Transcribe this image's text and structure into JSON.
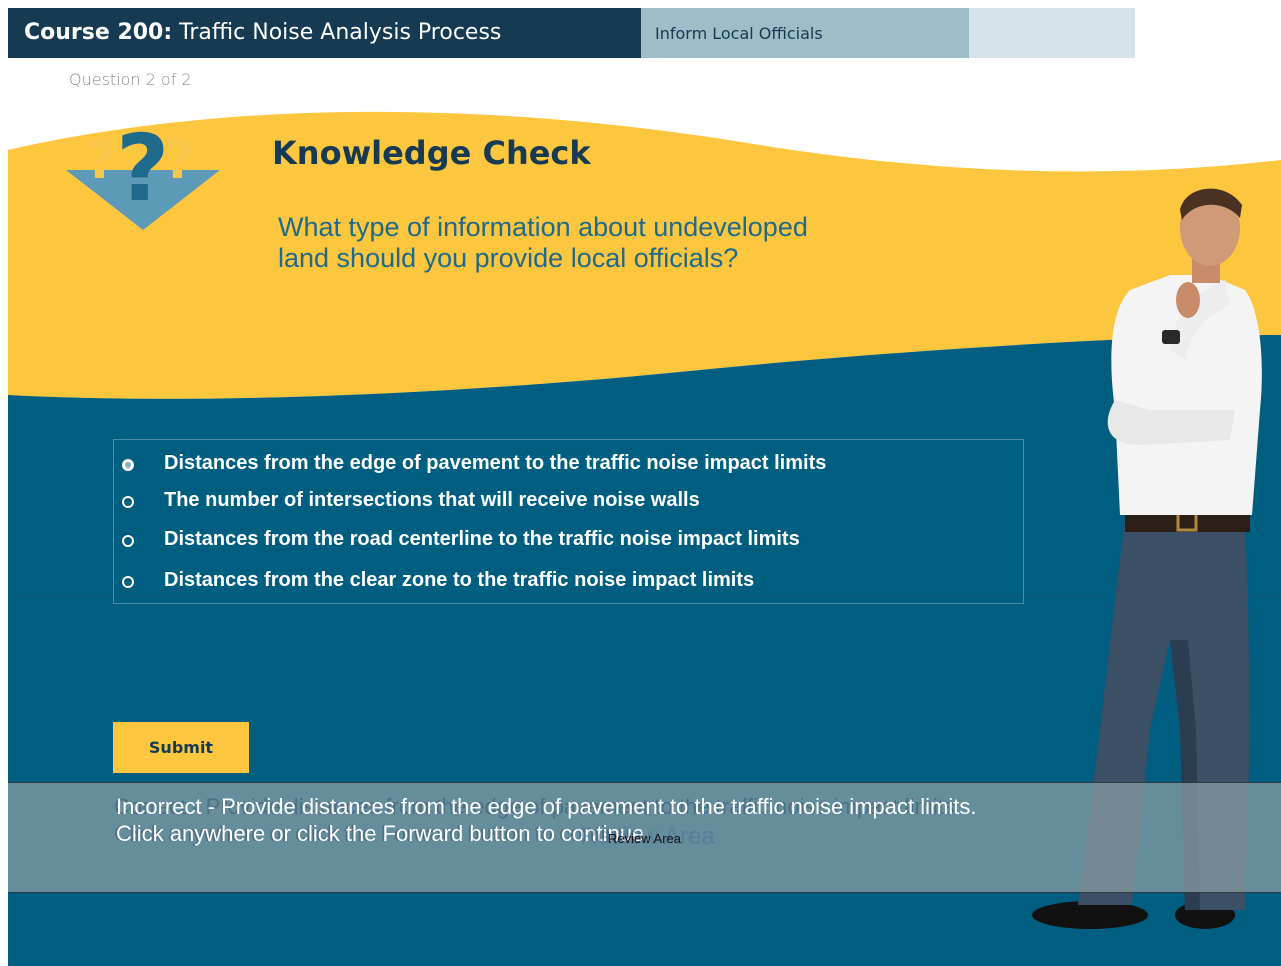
{
  "header": {
    "course_bold": "Course 200:",
    "course_title": "Traffic Noise Analysis Process",
    "tab_active": "Inform Local Officials"
  },
  "progress": "Question 2 of 2",
  "knowledge_check": {
    "title": "Knowledge Check",
    "question": "What type of information about undeveloped land should you provide local officials?"
  },
  "options": [
    {
      "label": "Distances from the edge of pavement to the traffic noise impact limits",
      "selected": true
    },
    {
      "label": "The number of intersections that will receive noise walls",
      "selected": false
    },
    {
      "label": "Distances from the road centerline to the traffic noise impact limits",
      "selected": false
    },
    {
      "label": "Distances from the clear zone to the traffic noise impact limits",
      "selected": false
    }
  ],
  "submit_label": "Submit",
  "feedback": {
    "overlay_ghost": "Correct - Provide distances from the edge of pavement to the traffic noise impact limits. Click anywhere or click the Forward button to continue.",
    "text": "Incorrect - Provide distances from the edge of pavement to the traffic noise impact limits. Click anywhere or click the Forward button to continue.",
    "review_ghost": "Review Area",
    "review_label": "Review Area"
  },
  "colors": {
    "navy": "#163a52",
    "teal": "#005f80",
    "yellow": "#fdc63f",
    "question_text": "#1f6a8a"
  },
  "icons": {
    "question_marks": "question-marks-icon",
    "radio": "radio-icon"
  }
}
